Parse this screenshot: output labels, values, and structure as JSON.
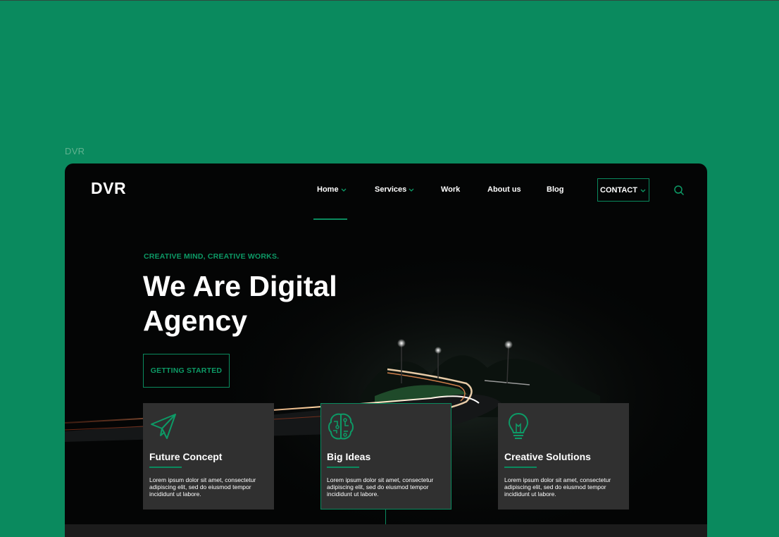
{
  "frame_label": "DVR",
  "brand": {
    "logo": "DVR"
  },
  "nav": {
    "items": [
      {
        "label": "Home",
        "has_dropdown": true,
        "active": true
      },
      {
        "label": "Services",
        "has_dropdown": true
      },
      {
        "label": "Work"
      },
      {
        "label": "About us"
      },
      {
        "label": "Blog"
      }
    ],
    "contact_label": "CONTACT"
  },
  "hero": {
    "tagline": "CREATIVE MIND, CREATIVE WORKS.",
    "headline": "We Are Digital Agency",
    "cta_label": "GETTING STARTED"
  },
  "cards": [
    {
      "title": "Future Concept",
      "text": "Lorem ipsum dolor sit amet, consectetur adipiscing elit, sed do eiusmod tempor incididunt ut labore.",
      "icon": "paper-plane-icon"
    },
    {
      "title": "Big Ideas",
      "text": "Lorem ipsum dolor sit amet, consectetur adipiscing elit, sed do eiusmod tempor incididunt ut labore.",
      "icon": "brain-circuit-icon",
      "active": true
    },
    {
      "title": "Creative Solutions",
      "text": "Lorem ipsum dolor sit amet, consectetur adipiscing elit, sed do eiusmod tempor incididunt ut labore.",
      "icon": "lightbulb-icon"
    }
  ],
  "colors": {
    "page_background": "#0a8a5e",
    "accent": "#0a8a5e",
    "hero_background": "#040505",
    "card_background": "#303030"
  }
}
